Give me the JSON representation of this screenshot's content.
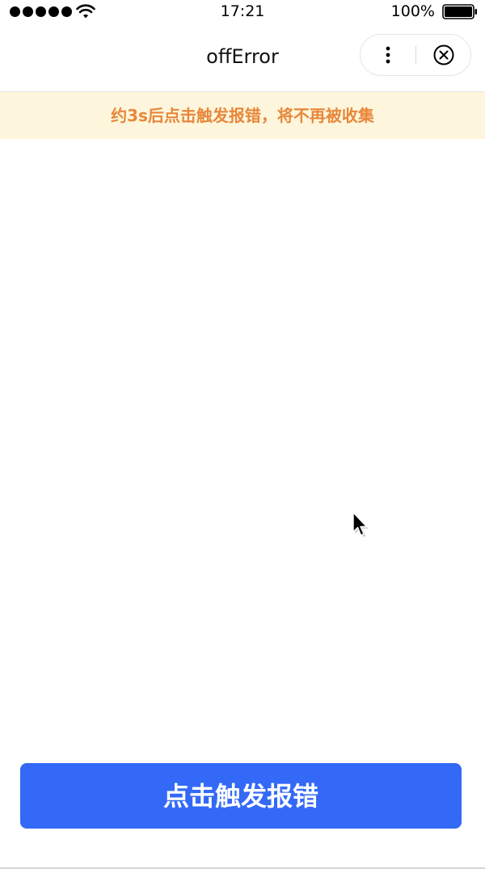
{
  "status_bar": {
    "time": "17:21",
    "battery_percent": "100%",
    "signal_icon": "signal-dots-icon",
    "wifi_icon": "wifi-icon",
    "battery_icon": "battery-icon"
  },
  "nav": {
    "title": "offError",
    "more_icon": "more-vertical-icon",
    "close_icon": "close-circle-icon"
  },
  "banner": {
    "text": "约3s后点击触发报错，将不再被收集",
    "text_color": "#e8873a",
    "background": "#fdf6dd"
  },
  "main": {
    "trigger_button_label": "点击触发报错",
    "button_color": "#3369f6"
  }
}
